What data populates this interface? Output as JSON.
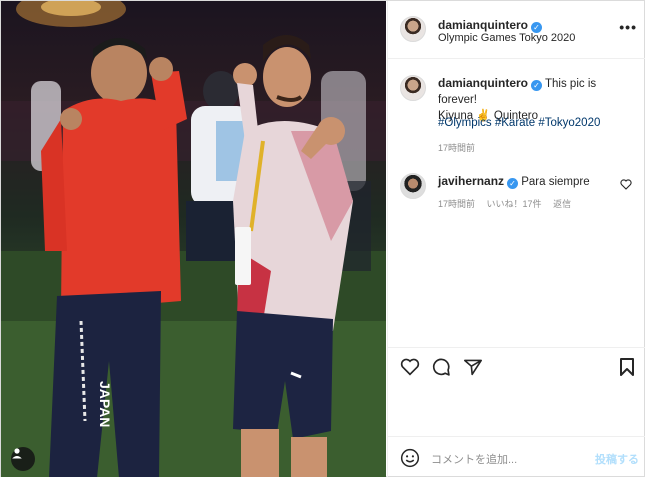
{
  "header": {
    "username": "damianquintero",
    "location": "Olympic Games Tokyo 2020",
    "more_icon": "more-horizontal-icon"
  },
  "caption": {
    "username": "damianquintero",
    "text": "This pic is forever!",
    "line2": "Kiyuna ✌️ Quintero",
    "hashtags": "#Olympics #Karate #Tokyo2020",
    "time": "17時間前"
  },
  "comment": {
    "username": "javihernanz",
    "text": "Para siempre",
    "time": "17時間前",
    "likes": "いいね！17件",
    "reply": "返信"
  },
  "photo": {
    "jersey_text": "JAPAN"
  },
  "add_comment": {
    "placeholder": "コメントを追加...",
    "post_label": "投稿する"
  },
  "colors": {
    "verified": "#3897f0",
    "link": "#00376b",
    "muted": "#8e8e8e",
    "post_disabled": "#b2dffc"
  }
}
